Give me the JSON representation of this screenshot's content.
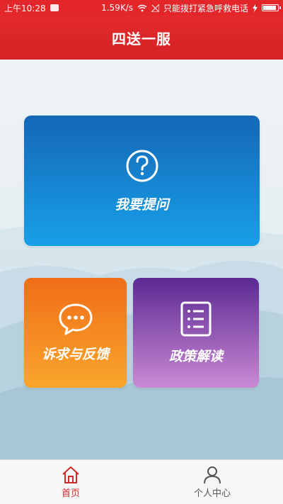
{
  "status_bar": {
    "time": "上午10:28",
    "network_speed": "1.59K/s",
    "carrier": "只能拨打紧急呼救电话"
  },
  "header": {
    "title": "四送一服"
  },
  "cards": {
    "ask": {
      "label": "我要提问",
      "icon": "question-circle-icon"
    },
    "feedback": {
      "label": "诉求与反馈",
      "icon": "chat-bubble-icon"
    },
    "policy": {
      "label": "政策解读",
      "icon": "document-list-icon"
    }
  },
  "bottom_nav": {
    "home": "首页",
    "personal": "个人中心"
  },
  "colors": {
    "brand_red": "#e3262a",
    "ask_card": "#1a8ad6",
    "feedback_card": "#f48822",
    "policy_card": "#8e56b3"
  }
}
